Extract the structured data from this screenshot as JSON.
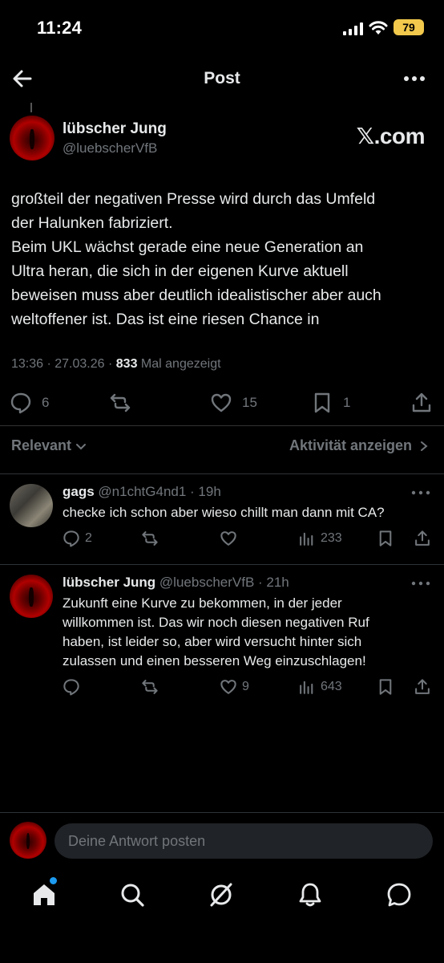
{
  "status_bar": {
    "time": "11:24",
    "battery": "79"
  },
  "header": {
    "title": "Post"
  },
  "post": {
    "author_name": "lübscher Jung",
    "author_handle": "@luebscherVfB",
    "brand": "𝕏.com",
    "lines": [
      "großteil der negativen Presse wird durch das Umfeld",
      "der Halunken fabriziert.",
      "Beim UKL wächst gerade eine neue Generation an",
      "Ultra heran, die sich in der eigenen Kurve aktuell",
      "beweisen muss aber deutlich idealistischer aber auch",
      "weltoffener ist. Das ist eine riesen Chance in"
    ],
    "timestamp": "13:36 · 27.03.26 · ",
    "views": "833",
    "views_label": " Mal angezeigt",
    "replies": "6",
    "likes": "15",
    "bookmarks": "1"
  },
  "sort": {
    "left": "Relevant",
    "right": "Aktivität anzeigen"
  },
  "replies": [
    {
      "name": "gags",
      "handle": "@n1chtG4nd1 · 19h",
      "lines": [
        "checke ich schon aber wieso chillt man dann mit CA?"
      ],
      "replies": "2",
      "likes": "",
      "views": "233"
    },
    {
      "name": "lübscher Jung",
      "handle": "@luebscherVfB · 21h",
      "lines": [
        "Zukunft eine Kurve zu bekommen, in der jeder",
        "willkommen ist. Das wir noch diesen negativen Ruf",
        "haben, ist leider so, aber wird versucht hinter sich",
        "zulassen und einen besseren Weg einzuschlagen!"
      ],
      "replies": "",
      "likes": "9",
      "views": "643"
    }
  ],
  "reply_bar": {
    "placeholder": "Deine Antwort posten"
  },
  "colors": {
    "background": "#000000",
    "text": "#e7e9ea",
    "muted": "#71767b",
    "accent": "#1d9bf0",
    "battery": "#f2c94c"
  },
  "icons": [
    "back-arrow-icon",
    "more-icon",
    "reply-icon",
    "repost-icon",
    "like-icon",
    "bookmark-icon",
    "share-icon",
    "views-icon",
    "home-icon",
    "search-icon",
    "grok-icon",
    "bell-icon",
    "messages-icon"
  ]
}
